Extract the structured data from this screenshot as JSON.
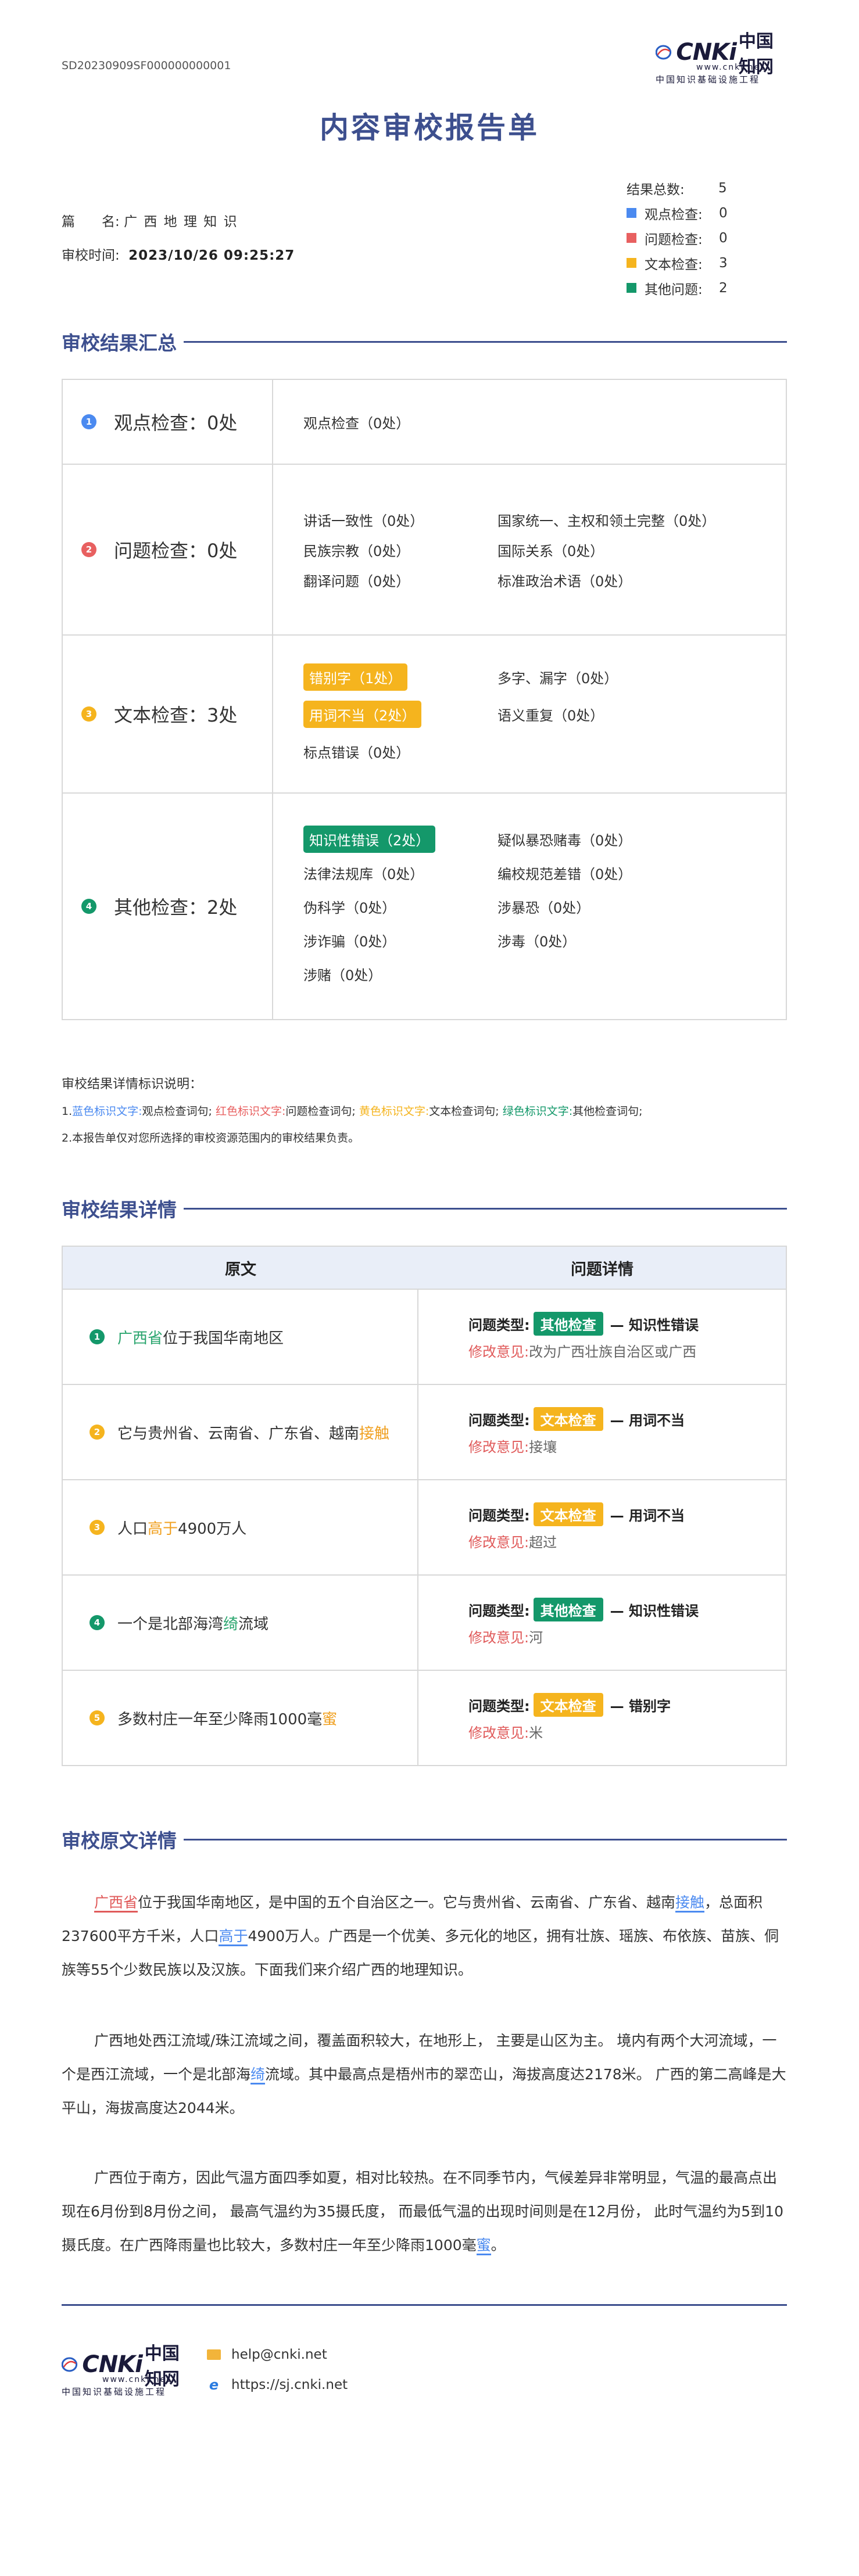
{
  "header": {
    "doc_id": "SD20230909SF000000000001",
    "logo_text": "CNKi",
    "logo_cn": "中国知网",
    "logo_url": "www.cnki.net",
    "logo_sub": "中国知识基础设施工程",
    "title": "内容审校报告单"
  },
  "meta": {
    "name_label": "篇　　名:",
    "name_value": "广 西 地 理 知 识",
    "time_label": "审校时间:",
    "time_value": "2023/10/26 09:25:27"
  },
  "stats": {
    "total_label": "结果总数:",
    "total_value": "5",
    "items": [
      {
        "label": "观点检查:",
        "value": "0",
        "color": "#4b8af0"
      },
      {
        "label": "问题检查:",
        "value": "0",
        "color": "#e86060"
      },
      {
        "label": "文本检查:",
        "value": "3",
        "color": "#f5b41e"
      },
      {
        "label": "其他问题:",
        "value": "2",
        "color": "#14986a"
      }
    ]
  },
  "summary": {
    "heading": "审校结果汇总",
    "rows": [
      {
        "num": "1",
        "title": "观点检查：0处",
        "color": "#4b8af0",
        "items": [
          "观点检查（0处）"
        ]
      },
      {
        "num": "2",
        "title": "问题检查：0处",
        "color": "#e86060",
        "items": [
          "讲话一致性（0处）",
          "国家统一、主权和领土完整（0处）",
          "民族宗教（0处）",
          "国际关系（0处）",
          "翻译问题（0处）",
          "标准政治术语（0处）"
        ]
      },
      {
        "num": "3",
        "title": "文本检查：3处",
        "color": "#f5b41e",
        "items": [
          "错别字（1处）",
          "多字、漏字（0处）",
          "用词不当（2处）",
          "语义重复（0处）",
          "标点错误（0处）"
        ]
      },
      {
        "num": "4",
        "title": "其他检查：2处",
        "color": "#14986a",
        "items": [
          "知识性错误（2处）",
          "疑似暴恐赌毒（0处）",
          "法律法规库（0处）",
          "编校规范差错（0处）",
          "伪科学（0处）",
          "涉暴恐（0处）",
          "涉诈骗（0处）",
          "涉毒（0处）",
          "涉赌（0处）"
        ]
      }
    ]
  },
  "legend": {
    "title": "审校结果详情标识说明：",
    "line1_prefix": "1.",
    "blue": "蓝色标识文字:",
    "blue_desc": "观点检查词句;",
    "red": "红色标识文字:",
    "red_desc": "问题检查词句;",
    "yellow": "黄色标识文字:",
    "yellow_desc": "文本检查词句;",
    "green": "绿色标识文字:",
    "green_desc": "其他检查词句;",
    "line2": "2.本报告单仅对您所选择的审校资源范围内的审校结果负责。"
  },
  "detail": {
    "heading": "审校结果详情",
    "col_original": "原文",
    "col_issue": "问题详情",
    "type_label": "问题类型:",
    "fix_label": "修改意见:",
    "rows": [
      {
        "num": "1",
        "color": "#14986a",
        "pre": "",
        "hl": "广西省",
        "post": "位于我国华南地区",
        "hl_class": "hl-green",
        "chip": "其他检查",
        "type": "— 知识性错误",
        "fix": "改为广西壮族自治区或广西"
      },
      {
        "num": "2",
        "color": "#f5b41e",
        "pre": "它与贵州省、云南省、广东省、越南",
        "hl": "接触",
        "post": "",
        "hl_class": "hl-orange",
        "chip": "文本检查",
        "type": "— 用词不当",
        "fix": "接壤"
      },
      {
        "num": "3",
        "color": "#f5b41e",
        "pre": "人口",
        "hl": "高于",
        "post": "4900万人",
        "hl_class": "hl-orange",
        "chip": "文本检查",
        "type": "— 用词不当",
        "fix": "超过"
      },
      {
        "num": "4",
        "color": "#14986a",
        "pre": "一个是北部海湾",
        "hl": "绮",
        "post": "流域",
        "hl_class": "hl-green",
        "chip": "其他检查",
        "type": "— 知识性错误",
        "fix": "河"
      },
      {
        "num": "5",
        "color": "#f5b41e",
        "pre": "多数村庄一年至少降雨1000毫",
        "hl": "蜜",
        "post": "",
        "hl_class": "hl-orange",
        "chip": "文本检查",
        "type": "— 错别字",
        "fix": "米"
      }
    ]
  },
  "original": {
    "heading": "审校原文详情",
    "p1": {
      "a": "广西省",
      "b": "位于我国华南地区，是中国的五个自治区之一。它与贵州省、云南省、广东省、越南",
      "c": "接触",
      "d": "，总面积237600平方千米，人口",
      "e": "高于",
      "f": "4900万人。广西是一个优美、多元化的地区，拥有壮族、瑶族、布依族、苗族、侗族等55个少数民族以及汉族。下面我们来介绍广西的地理知识。"
    },
    "p2": {
      "a": "广西地处西江流域/珠江流域之间，覆盖面积较大，在地形上， 主要是山区为主。 境内有两个大河流域，一个是西江流域，一个是北部海",
      "b": "绮",
      "c": "流域。其中最高点是梧州市的翠峦山，海拔高度达2178米。 广西的第二高峰是大平山，海拔高度达2044米。"
    },
    "p3": {
      "a": "广西位于南方，因此气温方面四季如夏，相对比较热。在不同季节内，气候差异非常明显，气温的最高点出现在6月份到8月份之间， 最高气温约为35摄氏度， 而最低气温的出现时间则是在12月份， 此时气温约为5到10摄氏度。在广西降雨量也比较大，多数村庄一年至少降雨1000毫",
      "b": "蜜",
      "c": "。"
    }
  },
  "footer": {
    "email": "help@cnki.net",
    "website": "https://sj.cnki.net"
  }
}
